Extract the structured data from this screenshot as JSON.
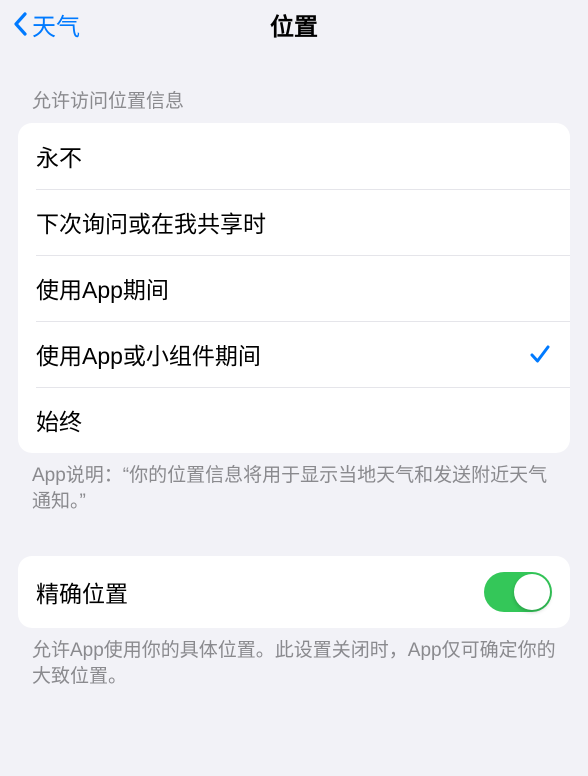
{
  "nav": {
    "back_label": "天气",
    "title": "位置"
  },
  "section1": {
    "header": "允许访问位置信息",
    "options": [
      {
        "label": "永不",
        "selected": false
      },
      {
        "label": "下次询问或在我共享时",
        "selected": false
      },
      {
        "label": "使用App期间",
        "selected": false
      },
      {
        "label": "使用App或小组件期间",
        "selected": true
      },
      {
        "label": "始终",
        "selected": false
      }
    ],
    "footer": "App说明：“你的位置信息将用于显示当地天气和发送附近天气通知。”"
  },
  "section2": {
    "row_label": "精确位置",
    "toggle_on": true,
    "footer": "允许App使用你的具体位置。此设置关闭时，App仅可确定你的大致位置。"
  },
  "colors": {
    "accent": "#007aff",
    "toggle_on": "#34c759"
  }
}
